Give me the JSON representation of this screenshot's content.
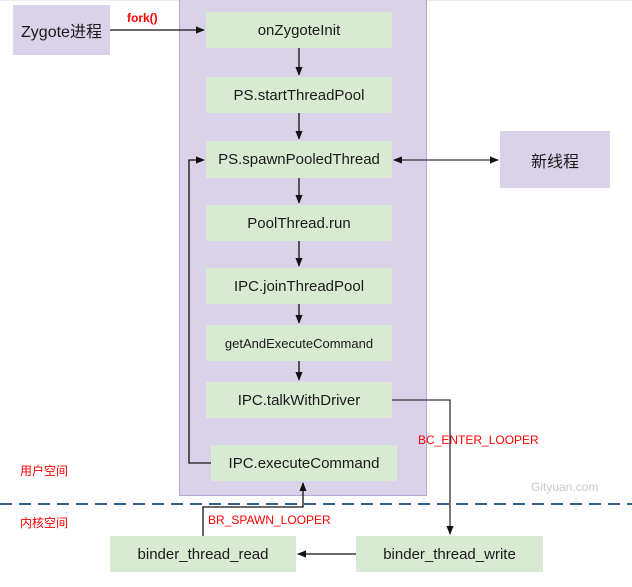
{
  "diagram": {
    "external_nodes": {
      "zygote": "Zygote进程",
      "new_thread": "新线程"
    },
    "user_space_nodes": [
      "onZygoteInit",
      "PS.startThreadPool",
      "PS.spawnPooledThread",
      "PoolThread.run",
      "IPC.joinThreadPool",
      "getAndExecuteCommand",
      "IPC.talkWithDriver",
      "IPC.executeCommand"
    ],
    "kernel_nodes": {
      "read": "binder_thread_read",
      "write": "binder_thread_write"
    },
    "edge_labels": {
      "fork": "fork()",
      "enter_looper": "BC_ENTER_LOOPER",
      "spawn_looper": "BR_SPAWN_LOOPER"
    },
    "regions": {
      "user_space": "用户空间",
      "kernel_space": "内核空间"
    },
    "watermark": "Gityuan.com",
    "colors": {
      "node_green": "#d9ead3",
      "node_purple": "#d9d2e9",
      "label_red": "#ff0000",
      "divider_blue": "#2f5f8f"
    }
  }
}
